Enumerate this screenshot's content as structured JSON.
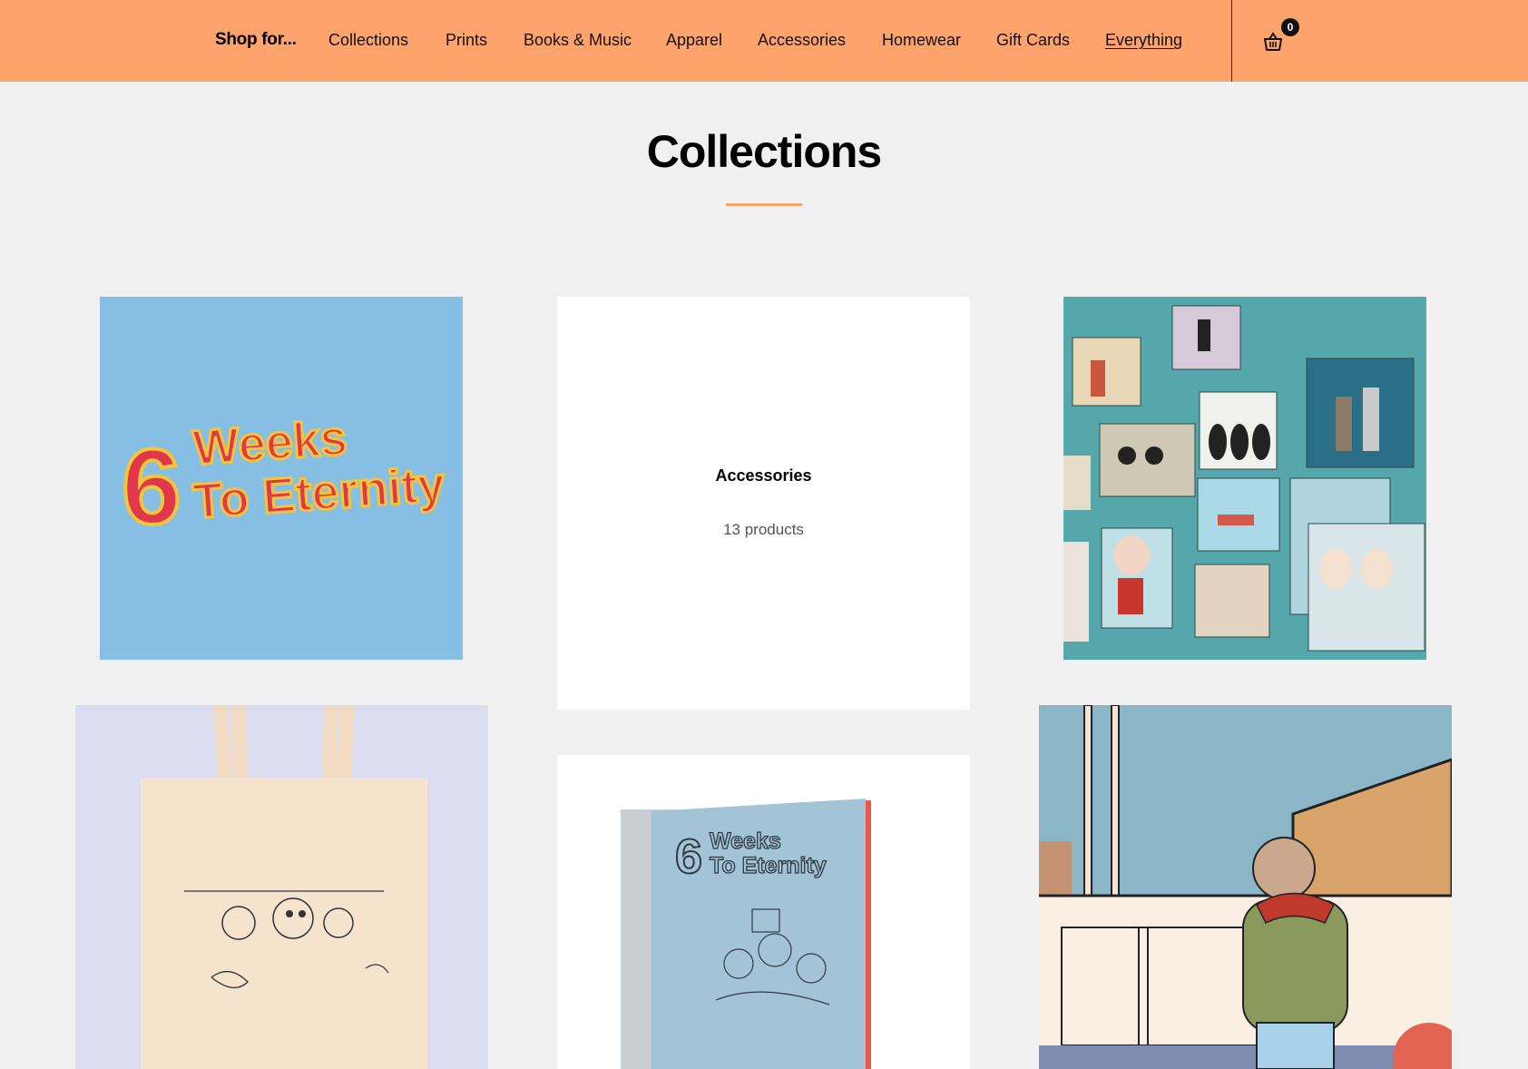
{
  "nav": {
    "label": "Shop for...",
    "items": [
      "Collections",
      "Prints",
      "Books & Music",
      "Apparel",
      "Accessories",
      "Homewear",
      "Gift Cards",
      "Everything"
    ],
    "active": "Everything"
  },
  "cart": {
    "count": "0",
    "icon": "basket-icon"
  },
  "page": {
    "title": "Collections"
  },
  "collections": [
    {
      "image": "6 Weeks To Eternity book cover art",
      "logo_text_line1": "Weeks",
      "logo_text_line2": "To Eternity",
      "logo_number": "6"
    },
    {
      "title": "Accessories",
      "count": "13 products"
    },
    {
      "image": "Wall of framed illustrated prints"
    },
    {
      "image": "Tote bag with dog illustration"
    },
    {
      "image": "6 Weeks To Eternity printed book",
      "logo_text_line1": "Weeks",
      "logo_text_line2": "To Eternity",
      "logo_number": "6"
    },
    {
      "image": "Illustration of boy looking out train window"
    }
  ],
  "colors": {
    "header": "#ffa36d",
    "accent": "#ffa36d",
    "background": "#f0f0f0"
  }
}
